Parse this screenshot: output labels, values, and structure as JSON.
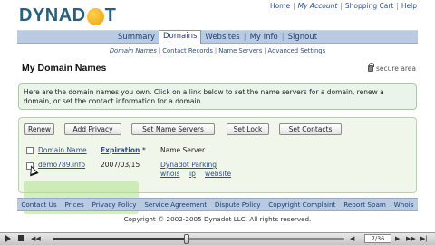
{
  "brand": {
    "logo_left": "DYNAD",
    "logo_right": "T"
  },
  "toplinks": [
    "Home",
    "My Account",
    "Shopping Cart",
    "Help"
  ],
  "nav": {
    "items": [
      "Summary",
      "Domains",
      "Websites",
      "My Info",
      "Signout"
    ],
    "active": "Domains"
  },
  "subnav": {
    "items": [
      "Domain Names",
      "Contact Records",
      "Name Servers",
      "Advanced Settings"
    ],
    "active": "Domain Names"
  },
  "page_title": "My Domain Names",
  "secure_label": "secure area",
  "info_text": "Here are the domain names you own. Click on a link below to set the name servers for a domain, renew a domain, or set the contact information for a domain.",
  "actions": [
    "Renew",
    "Add Privacy",
    "Set Name Servers",
    "Set Lock",
    "Set Contacts"
  ],
  "table": {
    "headers": {
      "domain": "Domain Name",
      "expiration": "Expiration",
      "sort_marker": "*",
      "nameserver": "Name Server"
    },
    "rows": [
      {
        "domain": "demo789.info",
        "expiration": "2007/03/15",
        "nameserver": "Dynadot Parking",
        "links": [
          "whois",
          "ip",
          "website"
        ]
      }
    ]
  },
  "footer": {
    "links": [
      "Contact Us",
      "Prices",
      "Privacy Policy",
      "Service Agreement",
      "Dispute Policy",
      "Copyright Complaint",
      "Report Spam",
      "Whois"
    ],
    "copyright": "Copyright © 2002-2005 Dynadot LLC. All rights reserved."
  },
  "player": {
    "progress": 0.46,
    "counter": "7/36"
  },
  "colors": {
    "nav_bg": "#b8cbe2",
    "link": "#2c4f8c",
    "info_bg": "#eaf4ea",
    "panel_bg": "#f1f6ea"
  }
}
